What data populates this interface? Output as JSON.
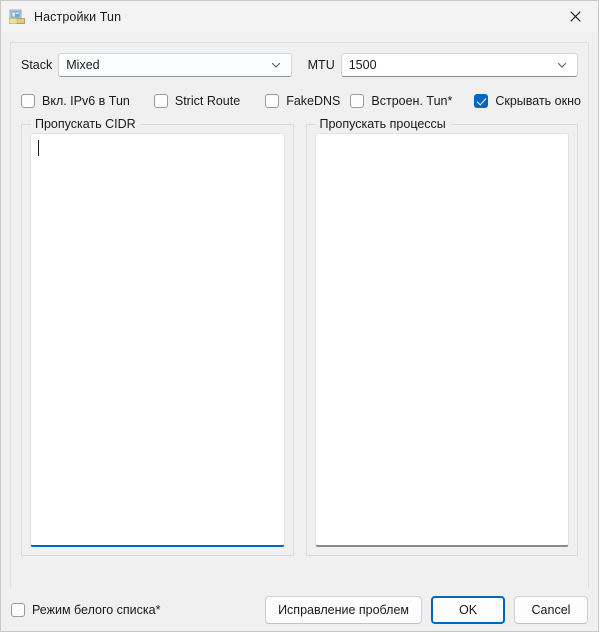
{
  "window": {
    "title": "Настройки Tun",
    "icon": "tun-settings-icon",
    "close_icon": "close-icon",
    "accent_color": "#0067c0"
  },
  "fields": {
    "stack": {
      "label": "Stack",
      "value": "Mixed",
      "chevron_icon": "chevron-down-icon"
    },
    "mtu": {
      "label": "MTU",
      "value": "1500",
      "chevron_icon": "chevron-down-icon"
    }
  },
  "checkboxes": {
    "ipv6": {
      "label": "Вкл. IPv6 в Tun",
      "checked": false
    },
    "strict_route": {
      "label": "Strict Route",
      "checked": false
    },
    "fakedns": {
      "label": "FakeDNS",
      "checked": false
    },
    "builtin_tun": {
      "label": "Встроен. Tun*",
      "checked": false
    },
    "hide_window": {
      "label": "Скрывать окно",
      "checked": true
    },
    "whitelist_mode": {
      "label": "Режим белого списка*",
      "checked": false
    }
  },
  "groups": {
    "cidr": {
      "title": "Пропускать CIDR",
      "value": "",
      "focused": true
    },
    "processes": {
      "title": "Пропускать процессы",
      "value": "",
      "focused": false
    }
  },
  "footer": {
    "fix_label": "Исправление проблем",
    "ok_label": "OK",
    "cancel_label": "Cancel"
  }
}
